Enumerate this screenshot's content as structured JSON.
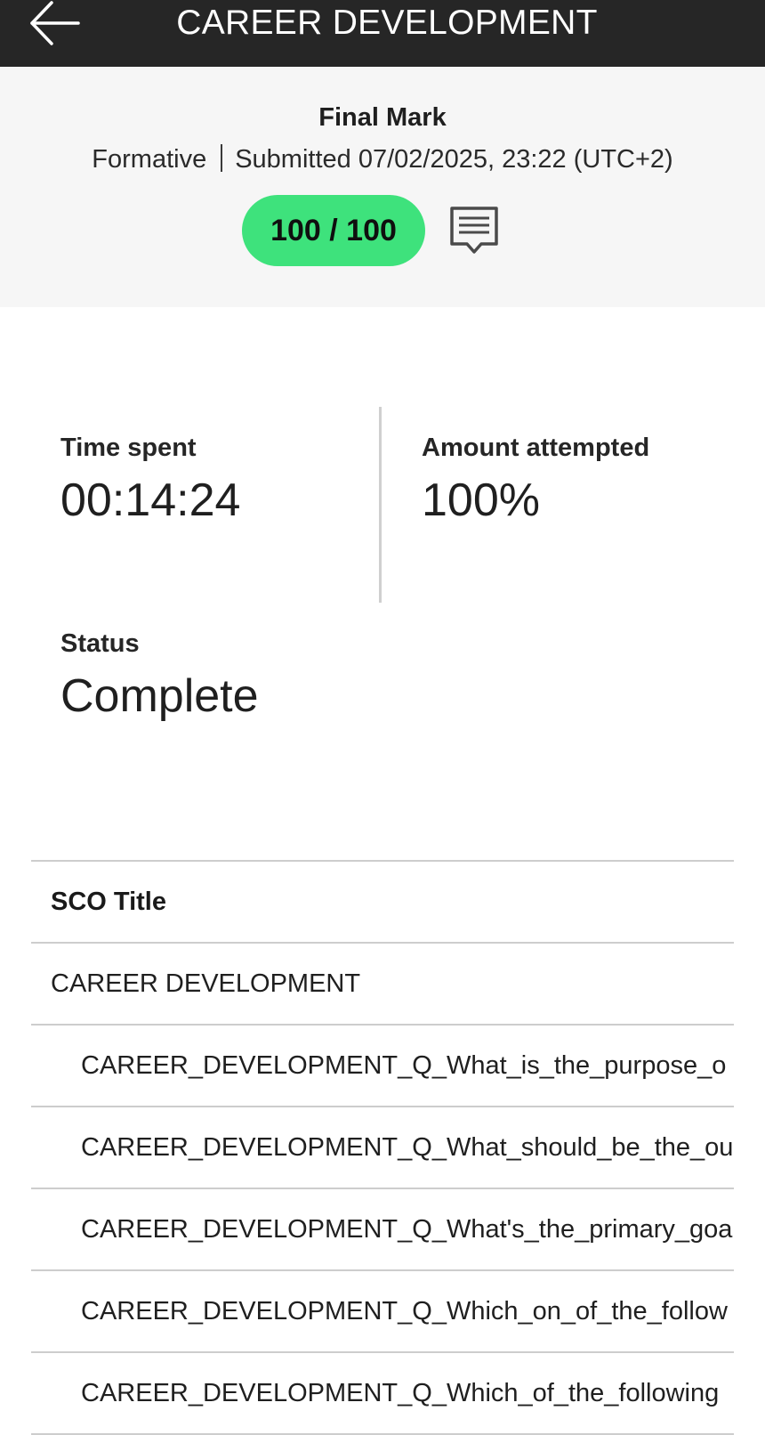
{
  "header": {
    "title": "CAREER DEVELOPMENT",
    "back_icon": "arrow-left-icon"
  },
  "summary": {
    "heading": "Final Mark",
    "assessment_type": "Formative",
    "submitted": "Submitted 07/02/2025, 23:22 (UTC+2)",
    "score": "100 / 100",
    "score_color": "#3ee27c",
    "feedback_icon": "comment-icon"
  },
  "stats": {
    "time_spent": {
      "label": "Time spent",
      "value": "00:14:24"
    },
    "amount_attempted": {
      "label": "Amount attempted",
      "value": "100%"
    },
    "status": {
      "label": "Status",
      "value": "Complete"
    }
  },
  "table": {
    "header": "SCO Title",
    "parent": "CAREER DEVELOPMENT",
    "children": [
      "CAREER_DEVELOPMENT_Q_What_is_the_purpose_o",
      "CAREER_DEVELOPMENT_Q_What_should_be_the_ou",
      "CAREER_DEVELOPMENT_Q_What's_the_primary_goa",
      "CAREER_DEVELOPMENT_Q_Which_on_of_the_follow",
      "CAREER_DEVELOPMENT_Q_Which_of_the_following"
    ]
  }
}
